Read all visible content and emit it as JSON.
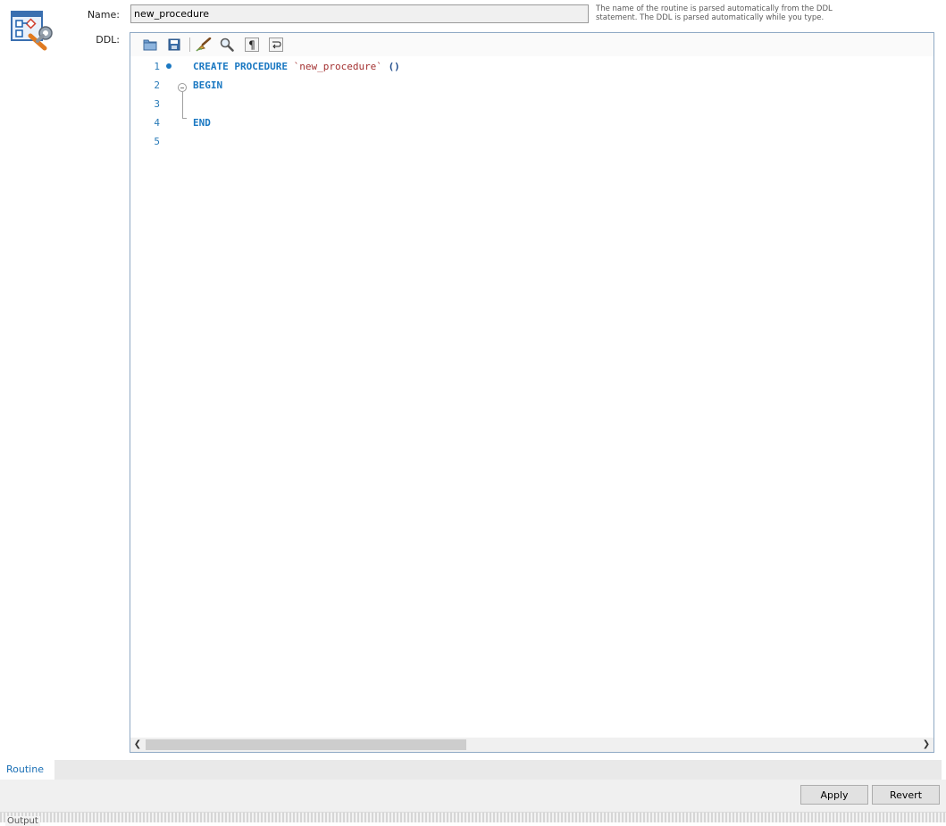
{
  "form": {
    "name_label": "Name:",
    "name_value": "new_procedure",
    "ddl_label": "DDL:",
    "hint": "The name of the routine is parsed automatically from the DDL statement. The DDL is parsed automatically while you type."
  },
  "toolbar": {
    "items": [
      {
        "icon": "open-folder-icon"
      },
      {
        "icon": "save-icon"
      },
      {
        "icon": "beautify-brush-icon"
      },
      {
        "icon": "find-icon"
      },
      {
        "icon": "pilcrow-icon"
      },
      {
        "icon": "word-wrap-icon"
      }
    ]
  },
  "editor": {
    "line_numbers": [
      "1",
      "2",
      "3",
      "4",
      "5"
    ],
    "lines": {
      "l1_kw": "CREATE PROCEDURE",
      "l1_name": "`new_procedure`",
      "l1_parens": "()",
      "l2_kw": "BEGIN",
      "l4_kw": "END"
    }
  },
  "tabs": {
    "routine": "Routine"
  },
  "buttons": {
    "apply": "Apply",
    "revert": "Revert"
  },
  "output": {
    "label": "Output"
  },
  "colors": {
    "keyword": "#1a78c2",
    "string": "#a33030",
    "line_number": "#2a7bb8",
    "tab_active_text": "#1a6fb5"
  }
}
